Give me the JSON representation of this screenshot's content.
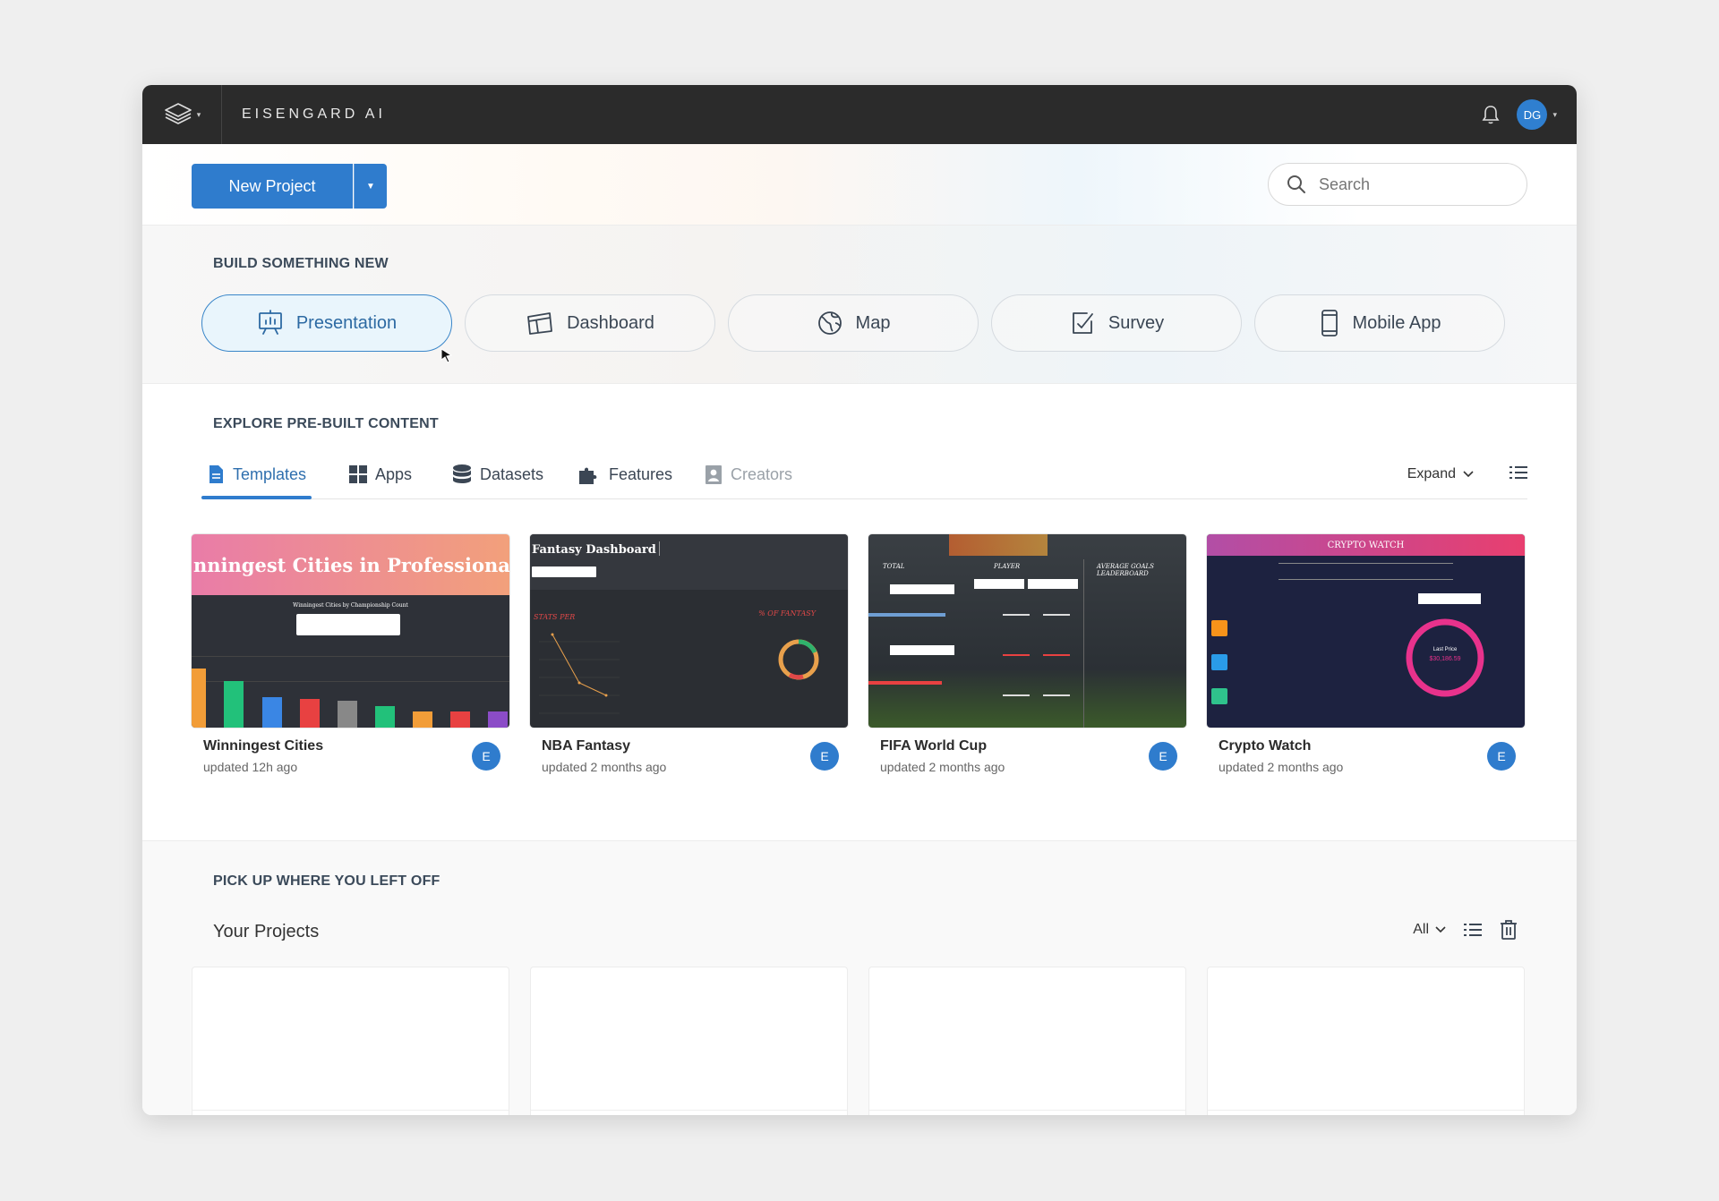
{
  "app": {
    "brand": "EISENGARD AI",
    "user_initials": "DG"
  },
  "toolbar": {
    "new_project": "New Project",
    "search_placeholder": "Search"
  },
  "build": {
    "title": "BUILD SOMETHING NEW",
    "items": [
      {
        "label": "Presentation",
        "icon": "presentation-icon",
        "active": true
      },
      {
        "label": "Dashboard",
        "icon": "dashboard-icon"
      },
      {
        "label": "Map",
        "icon": "globe-icon"
      },
      {
        "label": "Survey",
        "icon": "survey-icon"
      },
      {
        "label": "Mobile App",
        "icon": "mobile-icon"
      }
    ]
  },
  "explore": {
    "title": "EXPLORE PRE-BUILT CONTENT",
    "tabs": [
      {
        "label": "Templates",
        "icon": "document-icon",
        "active": true
      },
      {
        "label": "Apps",
        "icon": "grid-icon"
      },
      {
        "label": "Datasets",
        "icon": "database-icon"
      },
      {
        "label": "Features",
        "icon": "puzzle-icon"
      },
      {
        "label": "Creators",
        "icon": "badge-icon",
        "disabled": true
      }
    ],
    "expand_label": "Expand",
    "cards": [
      {
        "title": "Winningest Cities",
        "updated": "updated 12h ago",
        "avatar": "E",
        "thumb_title": "nningest Cities in Professional Sports",
        "thumb_subtitle": "Winningest Cities by Championship Count"
      },
      {
        "title": "NBA Fantasy",
        "updated": "updated 2 months ago",
        "avatar": "E",
        "thumb_title": "Fantasy Dashboard",
        "thumb_left": "STATS PER",
        "thumb_right": "% OF FANTASY"
      },
      {
        "title": "FIFA World Cup",
        "updated": "updated 2 months ago",
        "avatar": "E",
        "thumb_cols": [
          "TOTAL",
          "PLAYER",
          "AVERAGE GOALS LEADERBOARD"
        ]
      },
      {
        "title": "Crypto Watch",
        "updated": "updated 2 months ago",
        "avatar": "E",
        "thumb_title": "CRYPTO WATCH",
        "thumb_center": "Last Price",
        "thumb_value": "$30,186.59"
      }
    ]
  },
  "pickup": {
    "title": "PICK UP WHERE YOU LEFT OFF",
    "subtitle": "Your Projects",
    "filter": "All"
  },
  "colors": {
    "accent": "#2f7ccd",
    "topbar": "#2b2b2b"
  }
}
